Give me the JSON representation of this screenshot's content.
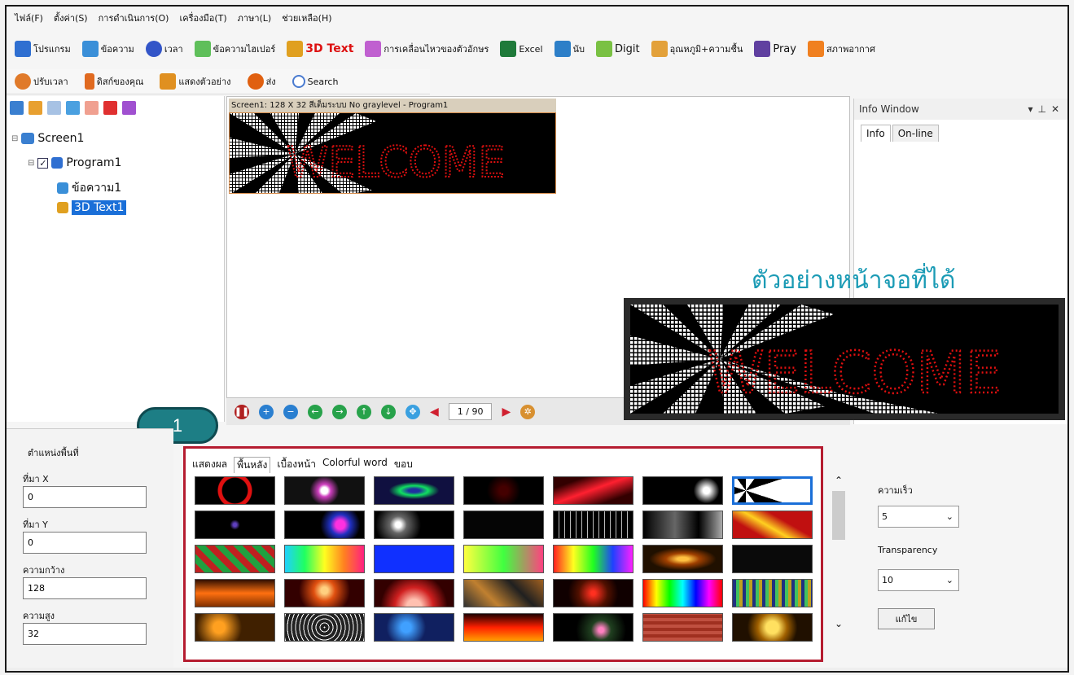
{
  "menu": [
    "ไฟล์(F)",
    "ตั้งค่า(S)",
    "การดำเนินการ(O)",
    "เครื่องมือ(T)",
    "ภาษา(L)",
    "ช่วยเหลือ(H)"
  ],
  "toolbar1": [
    {
      "label": "โปรแกรม",
      "icon": "program-icon",
      "color": "#2f6fd1"
    },
    {
      "label": "ข้อความ",
      "icon": "text-icon",
      "color": "#3a8fd8"
    },
    {
      "label": "เวลา",
      "icon": "clock-icon",
      "color": "#3355c8"
    },
    {
      "label": "ข้อความไฮเปอร์",
      "icon": "hypertext-icon",
      "color": "#5fbf5a"
    },
    {
      "label": "3D Text",
      "icon": "cube-icon",
      "color": "#e0a020"
    },
    {
      "label": "การเคลื่อนไหวของตัวอักษร",
      "icon": "animation-icon",
      "color": "#c060d0"
    },
    {
      "label": "Excel",
      "icon": "excel-icon",
      "color": "#1f7a3a"
    },
    {
      "label": "นับ",
      "icon": "counter-icon",
      "color": "#2d7fc8"
    },
    {
      "label": "Digit",
      "icon": "digit-icon",
      "color": "#7ac143"
    },
    {
      "label": "อุณหภูมิ+ความชื้น",
      "icon": "thermometer-icon",
      "color": "#e3a13a"
    },
    {
      "label": "Pray",
      "icon": "pray-icon",
      "color": "#6040a0"
    },
    {
      "label": "สภาพอากาศ",
      "icon": "weather-icon",
      "color": "#f08020"
    }
  ],
  "toolbar2": [
    {
      "label": "ปรับเวลา",
      "icon": "adjust-time-icon",
      "color": "#e07a2a"
    },
    {
      "label": "ดิสก์ของคุณ",
      "icon": "disk-icon",
      "color": "#e06a20"
    },
    {
      "label": "แสดงตัวอย่าง",
      "icon": "preview-icon",
      "color": "#e09020"
    },
    {
      "label": "ส่ง",
      "icon": "send-icon",
      "color": "#e06010"
    },
    {
      "label": "Search",
      "icon": "search-icon",
      "color": "#4a7bd0"
    }
  ],
  "tree": {
    "screen": "Screen1",
    "program": "Program1",
    "text": "ข้อความ1",
    "text3d": "3D Text1"
  },
  "screenbar": "Screen1: 128 X 32  สีเต็มระบบ  No graylevel - Program1",
  "led_text": "WELCOME",
  "playbar": {
    "page": "1 / 90"
  },
  "info": {
    "title": "Info Window",
    "tabs": [
      "Info",
      "On-line"
    ]
  },
  "caption": "ตัวอย่างหน้าจอที่ได้",
  "callout": "1",
  "position": {
    "title": "ตำแหน่งพื้นที่",
    "fields": [
      {
        "label": "ที่มา X",
        "value": "0"
      },
      {
        "label": "ที่มา Y",
        "value": "0"
      },
      {
        "label": "ความกว้าง",
        "value": "128"
      },
      {
        "label": "ความสูง",
        "value": "32"
      }
    ]
  },
  "effect_tabs": [
    "แสดงผล",
    "พื้นหลัง",
    "เบื้องหน้า",
    "Colorful word",
    "ขอบ"
  ],
  "settings": {
    "speed_label": "ความเร็ว",
    "speed_value": "5",
    "transparency_label": "Transparency",
    "transparency_value": "10",
    "edit_button": "แก้ไข"
  },
  "colors": {
    "accent": "#1d7e85",
    "highlight": "#b51c30",
    "caption": "#1b9bb5",
    "led": "#e01010"
  }
}
